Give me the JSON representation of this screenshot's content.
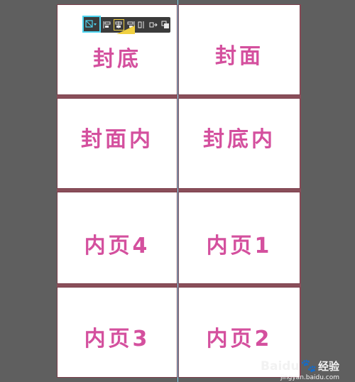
{
  "panels": [
    {
      "label": "封底"
    },
    {
      "label": "封面"
    },
    {
      "label": "封面内"
    },
    {
      "label": "封底内"
    },
    {
      "label": "内页4"
    },
    {
      "label": "内页1"
    },
    {
      "label": "内页3"
    },
    {
      "label": "内页2"
    }
  ],
  "toolbar": {
    "icons": [
      "frame-dropdown-icon",
      "align-left-icon",
      "align-center-icon",
      "align-right-icon",
      "distribute-icon",
      "arrange-icon",
      "layers-icon"
    ]
  },
  "watermark": {
    "brand": "Baidu",
    "brand_cn": "经验",
    "url": "jingyan.baidu.com"
  },
  "colors": {
    "label": "#d4509e",
    "background": "#5f5f5f",
    "guide": "#7fd0f0",
    "toolbar_highlight": "#4dd4f0",
    "toolbar_selected": "#f0d040"
  }
}
